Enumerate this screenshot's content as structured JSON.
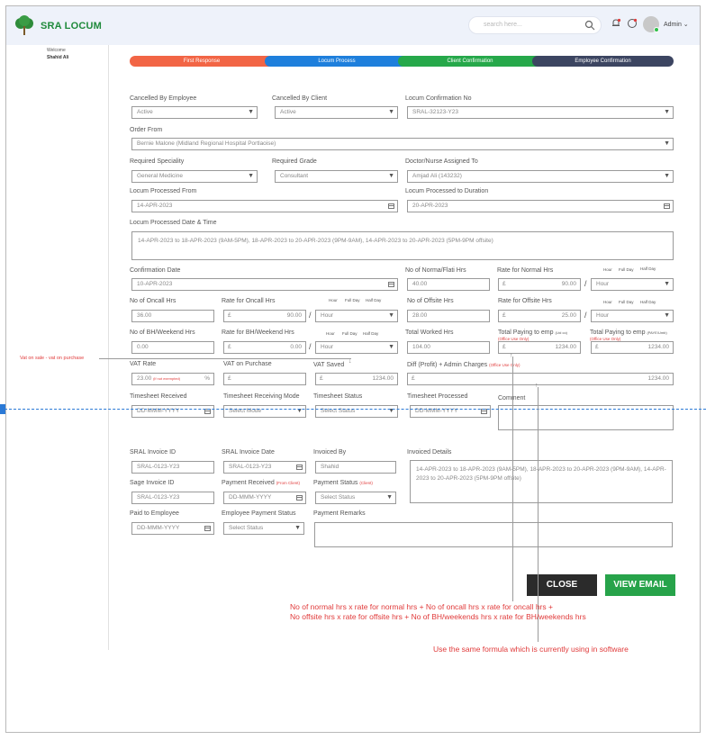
{
  "app": {
    "brand": "SRA LOCUM",
    "search_placeholder": "search here...",
    "user": "Admin",
    "welcome": "Welcome",
    "welcome_name": "Shahid Ali"
  },
  "steps": [
    "First Response",
    "Locum Process",
    "Client Confirmation",
    "Employee Confirmation"
  ],
  "step_colors": [
    "#f26545",
    "#1e7fdc",
    "#26a84a",
    "#3c4561"
  ],
  "form": {
    "cancelled_by_employee": {
      "label": "Cancelled By Employee",
      "value": "Active"
    },
    "cancelled_by_client": {
      "label": "Cancelled By Client",
      "value": "Active"
    },
    "locum_confirmation_no": {
      "label": "Locum Confirmation No",
      "value": "SRAL-32123-Y23"
    },
    "order_from": {
      "label": "Order From",
      "value": "Bernie Malone (Midland Regional Hospital Portlaoise)"
    },
    "required_speciality": {
      "label": "Required Speciality",
      "value": "General Medicine"
    },
    "required_grade": {
      "label": "Required Grade",
      "value": "Consultant"
    },
    "doctor_assigned": {
      "label": "Doctor/Nurse Assigned To",
      "value": "Amjad Ali (143232)"
    },
    "processed_from": {
      "label": "Locum Processed From",
      "value": "14-APR-2023"
    },
    "processed_duration": {
      "label": "Locum Processed to Duration",
      "value": "20-APR-2023"
    },
    "processed_datetime": {
      "label": "Locum Processed Date & Time",
      "value": "14-APR-2023 to 18-APR-2023 (9AM-5PM), 18-APR-2023 to 20-APR-2023 (9PM-9AM), 14-APR-2023 to 20-APR-2023 (5PM-9PM offsite)"
    },
    "confirmation_date": {
      "label": "Confirmation Date",
      "value": "10-APR-2023"
    },
    "normal_hrs": {
      "label": "No of Norma/Flati Hrs",
      "value": "40.00"
    },
    "rate_normal": {
      "label": "Rate for Normal Hrs",
      "currency": "£",
      "value": "90.00",
      "unit": "Hour"
    },
    "oncall_hrs": {
      "label": "No of Oncall Hrs",
      "value": "36.00"
    },
    "rate_oncall": {
      "label": "Rate for Oncall Hrs",
      "currency": "£",
      "value": "90.00",
      "unit": "Hour"
    },
    "offsite_hrs": {
      "label": "No of Offsite Hrs",
      "value": "28.00"
    },
    "rate_offsite": {
      "label": "Rate for Offsite Hrs",
      "currency": "£",
      "value": "25.00",
      "unit": "Hour"
    },
    "bh_hrs": {
      "label": "No of BH/Weekend Hrs",
      "value": "0.00"
    },
    "rate_bh": {
      "label": "Rate for BH/Weekend Hrs",
      "currency": "£",
      "value": "0.00",
      "unit": "Hour"
    },
    "total_worked": {
      "label": "Total Worked Hrs",
      "value": "104.00"
    },
    "total_pay_1": {
      "label": "Total Paying to emp",
      "tag": "(Ltd co)",
      "note": "(Office Use Only)",
      "currency": "£",
      "value": "1234.00"
    },
    "total_pay_2": {
      "label": "Total Paying to emp",
      "tag": "(PAYE/Umb)",
      "note": "(Office Use Only)",
      "currency": "£",
      "value": "1234.00"
    },
    "vat_rate": {
      "label": "VAT Rate",
      "value": "23.00",
      "note": "(if not exempted)",
      "suffix": "%"
    },
    "vat_purchase": {
      "label": "VAT on Purchase",
      "currency": "£",
      "value": ""
    },
    "vat_saved": {
      "label": "VAT Saved",
      "currency": "£",
      "value": "1234.00"
    },
    "diff_profit": {
      "label": "Diff (Profit) + Admin Charges",
      "note": "(Office Use Only)",
      "currency": "£",
      "value": "1234.00"
    },
    "ts_received": {
      "label": "Timesheet Received",
      "value": "DD-MMM-YYYY"
    },
    "ts_mode": {
      "label": "Timesheet Receiving Mode",
      "value": "Select Mode"
    },
    "ts_status": {
      "label": "Timesheet Status",
      "value": "Select Status"
    },
    "ts_processed": {
      "label": "Timesheet Processed",
      "value": "DD-MMM-YYYY"
    },
    "comment": {
      "label": "Comment",
      "value": ""
    },
    "sral_invoice_id": {
      "label": "SRAL Invoice ID",
      "value": "SRAL-0123-Y23"
    },
    "sral_invoice_date": {
      "label": "SRAL Invoice Date",
      "value": "SRAL-0123-Y23"
    },
    "invoiced_by": {
      "label": "Invoiced By",
      "value": "Shahid"
    },
    "invoiced_details": {
      "label": "Invoiced Details",
      "value": "14-APR-2023 to 18-APR-2023 (9AM-5PM), 18-APR-2023 to 20-APR-2023 (9PM-9AM), 14-APR-2023 to 20-APR-2023 (5PM-9PM offsite)"
    },
    "sage_invoice_id": {
      "label": "Sage Invoice ID",
      "value": "SRAL-0123-Y23"
    },
    "payment_received": {
      "label": "Payment Received",
      "note": "(From Client)",
      "value": "DD-MMM-YYYY"
    },
    "payment_status": {
      "label": "Payment Status",
      "note": "(Client)",
      "value": "Select Status"
    },
    "paid_to_employee": {
      "label": "Paid to Employee",
      "value": "DD-MMM-YYYY"
    },
    "employee_payment_status": {
      "label": "Employee Payment Status",
      "value": "Select Status"
    },
    "payment_remarks": {
      "label": "Payment Remarks",
      "value": ""
    }
  },
  "rate_units": {
    "hour": "Hour",
    "full_day": "Full Day",
    "half_day": "Half Day"
  },
  "buttons": {
    "close": "CLOSE",
    "view_email": "VIEW EMAIL"
  },
  "annotations": {
    "vat_note": "Vat on sale - vat on purchase",
    "formula_1": "No of normal hrs x rate for normal hrs + No of oncall hrs x rate for oncall hrs +",
    "formula_2": "No offsite hrs x rate for offsite hrs + No of BH/weekends hrs x rate for BH/weekends hrs",
    "same_formula": "Use the same formula which is currently using in software"
  },
  "colors": {
    "brand_green": "#1f8a3b",
    "close_btn": "#2b2b2b",
    "view_email_btn": "#27a34a",
    "annotation_red": "#e03a3a",
    "guide_blue": "#2a79d6"
  }
}
